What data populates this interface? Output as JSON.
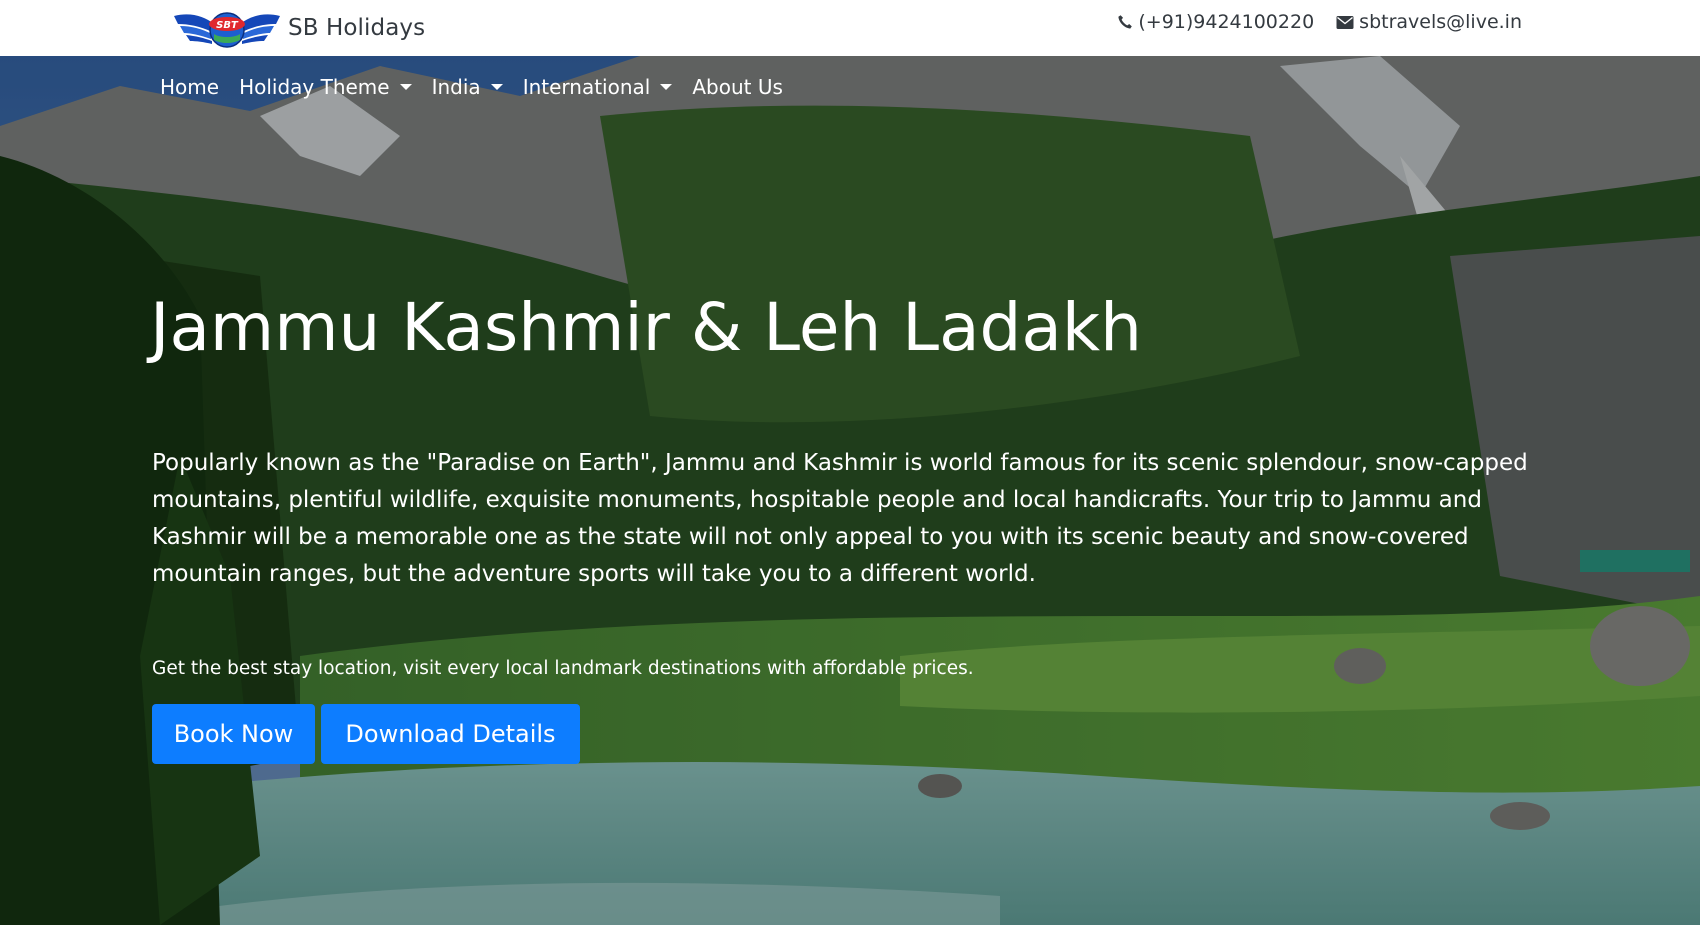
{
  "header": {
    "brand_name": "SB Holidays",
    "logo_text": "SBT",
    "phone": "(+91)9424100220",
    "email": "sbtravels@live.in",
    "icons": {
      "phone": "phone-icon",
      "email": "envelope-icon"
    }
  },
  "nav": {
    "items": [
      {
        "label": "Home",
        "dropdown": false
      },
      {
        "label": "Holiday Theme",
        "dropdown": true
      },
      {
        "label": "India",
        "dropdown": true
      },
      {
        "label": "International",
        "dropdown": true
      },
      {
        "label": "About Us",
        "dropdown": false
      }
    ]
  },
  "hero": {
    "title": "Jammu Kashmir & Leh Ladakh",
    "description": "Popularly known as the \"Paradise on Earth\", Jammu and Kashmir is world famous for its scenic splendour, snow-capped mountains, plentiful wildlife, exquisite monuments, hospitable people and local handicrafts. Your trip to Jammu and Kashmir will be a memorable one as the state will not only appeal to you with its scenic beauty and snow-covered mountain ranges, but the adventure sports will take you to a different world.",
    "subtext": "Get the best stay location, visit every local landmark destinations with affordable prices.",
    "book_label": "Book Now",
    "download_label": "Download Details"
  },
  "colors": {
    "primary_button": "#0d7dff",
    "header_text": "#343a40",
    "hero_text": "#ffffff",
    "logo_blue": "#1547b8",
    "logo_red": "#e0282e"
  }
}
